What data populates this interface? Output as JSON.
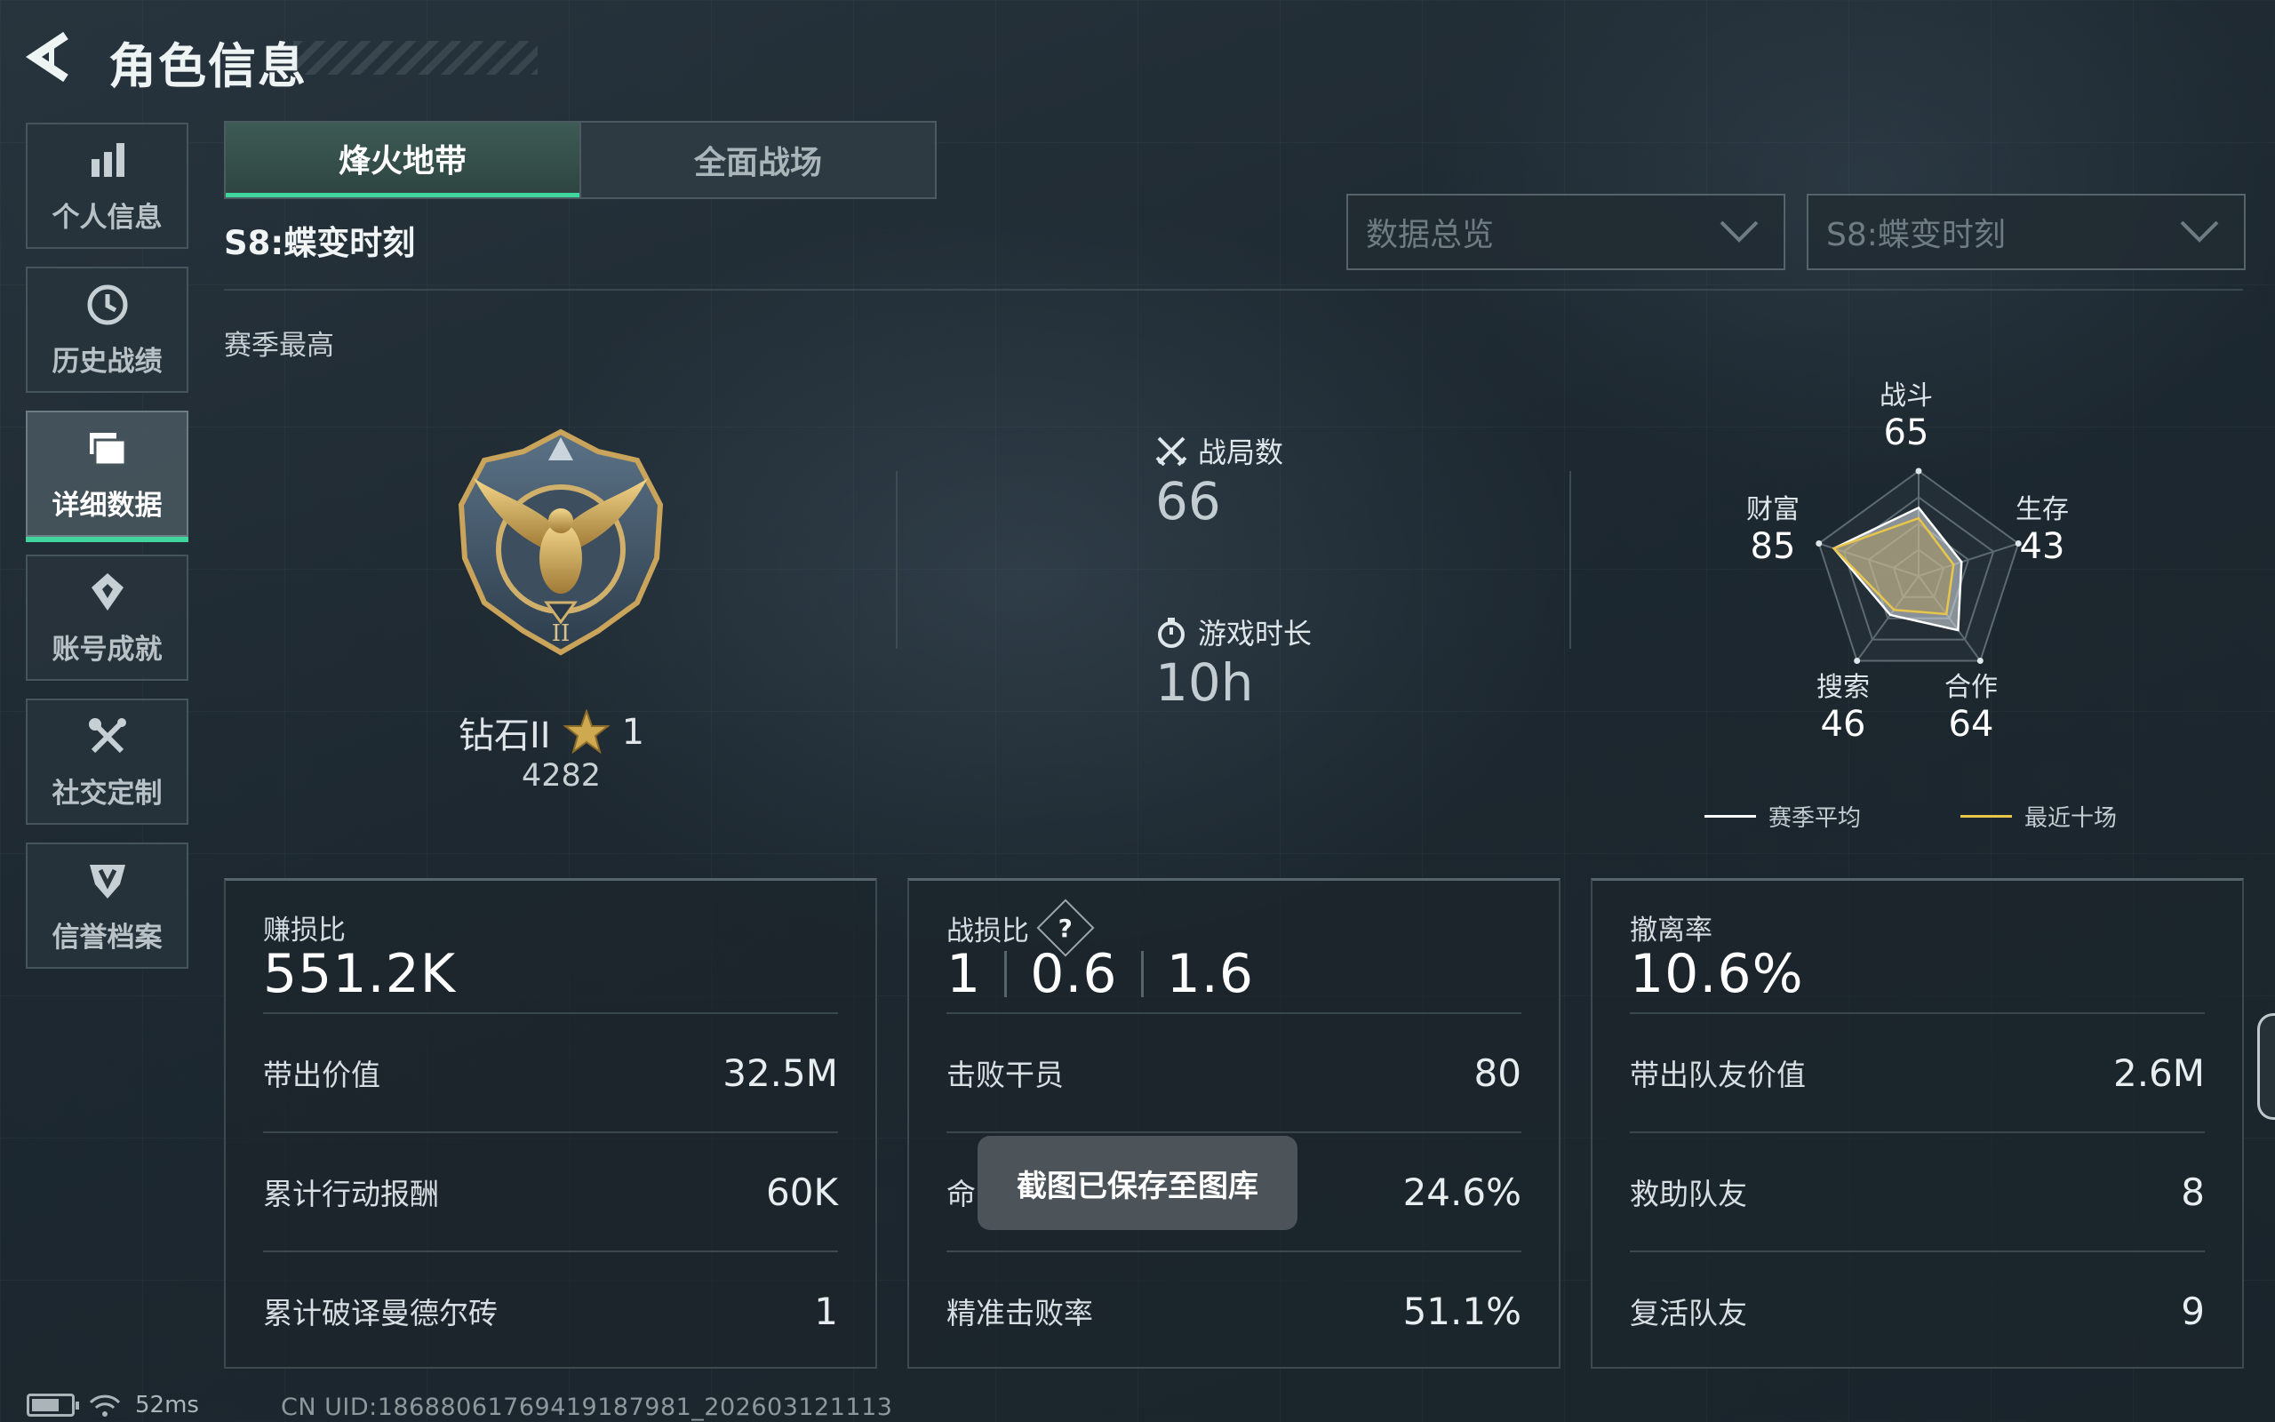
{
  "header": {
    "title": "角色信息"
  },
  "sidebar": {
    "items": [
      {
        "label": "个人信息",
        "icon": "bar-chart-icon",
        "active": false
      },
      {
        "label": "历史战绩",
        "icon": "history-clock-icon",
        "active": false
      },
      {
        "label": "详细数据",
        "icon": "folder-data-icon",
        "active": true
      },
      {
        "label": "账号成就",
        "icon": "achievement-badge-icon",
        "active": false
      },
      {
        "label": "社交定制",
        "icon": "wrench-tools-icon",
        "active": false
      },
      {
        "label": "信誉档案",
        "icon": "shield-emblem-icon",
        "active": false
      }
    ]
  },
  "tabs": [
    {
      "label": "烽火地带",
      "active": true
    },
    {
      "label": "全面战场",
      "active": false
    }
  ],
  "season": {
    "name": "S8:蝶变时刻",
    "section_label": "赛季最高"
  },
  "filters": {
    "data_view": "数据总览",
    "season": "S8:蝶变时刻"
  },
  "rank": {
    "tier": "钻石II",
    "stars": "1",
    "score": "4282"
  },
  "summary": {
    "matches_label": "战局数",
    "matches_value": "66",
    "playtime_label": "游戏时长",
    "playtime_value": "10h"
  },
  "radar": {
    "axes": [
      {
        "label": "战斗",
        "value": "65"
      },
      {
        "label": "生存",
        "value": "43"
      },
      {
        "label": "合作",
        "value": "64"
      },
      {
        "label": "搜索",
        "value": "46"
      },
      {
        "label": "财富",
        "value": "85"
      }
    ],
    "season_values": [
      65,
      43,
      64,
      46,
      85
    ],
    "recent_values": [
      55,
      35,
      45,
      40,
      85
    ],
    "legend_season": "赛季平均",
    "legend_recent": "最近十场",
    "season_color": "#ffffff",
    "recent_color": "#e8c64a"
  },
  "cards": {
    "profit": {
      "label": "赚损比",
      "value": "551.2K",
      "rows": [
        {
          "k": "带出价值",
          "v": "32.5M"
        },
        {
          "k": "累计行动报酬",
          "v": "60K"
        },
        {
          "k": "累计破译曼德尔砖",
          "v": "1"
        }
      ]
    },
    "combat": {
      "label": "战损比",
      "help": "?",
      "ratio": [
        "1",
        "0.6",
        "1.6"
      ],
      "rows": [
        {
          "k": "击败干员",
          "v": "80"
        },
        {
          "k": "命",
          "v": "24.6%"
        },
        {
          "k": "精准击败率",
          "v": "51.1%"
        }
      ]
    },
    "extract": {
      "label": "撤离率",
      "value": "10.6%",
      "rows": [
        {
          "k": "带出队友价值",
          "v": "2.6M"
        },
        {
          "k": "救助队友",
          "v": "8"
        },
        {
          "k": "复活队友",
          "v": "9"
        }
      ]
    }
  },
  "toast": {
    "text": "截图已保存至图库"
  },
  "status": {
    "ping": "52ms",
    "uid": "CN UID:18688061769419187981_202603121113"
  },
  "colors": {
    "accent": "#3fd59c",
    "gold": "#e8c64a"
  }
}
